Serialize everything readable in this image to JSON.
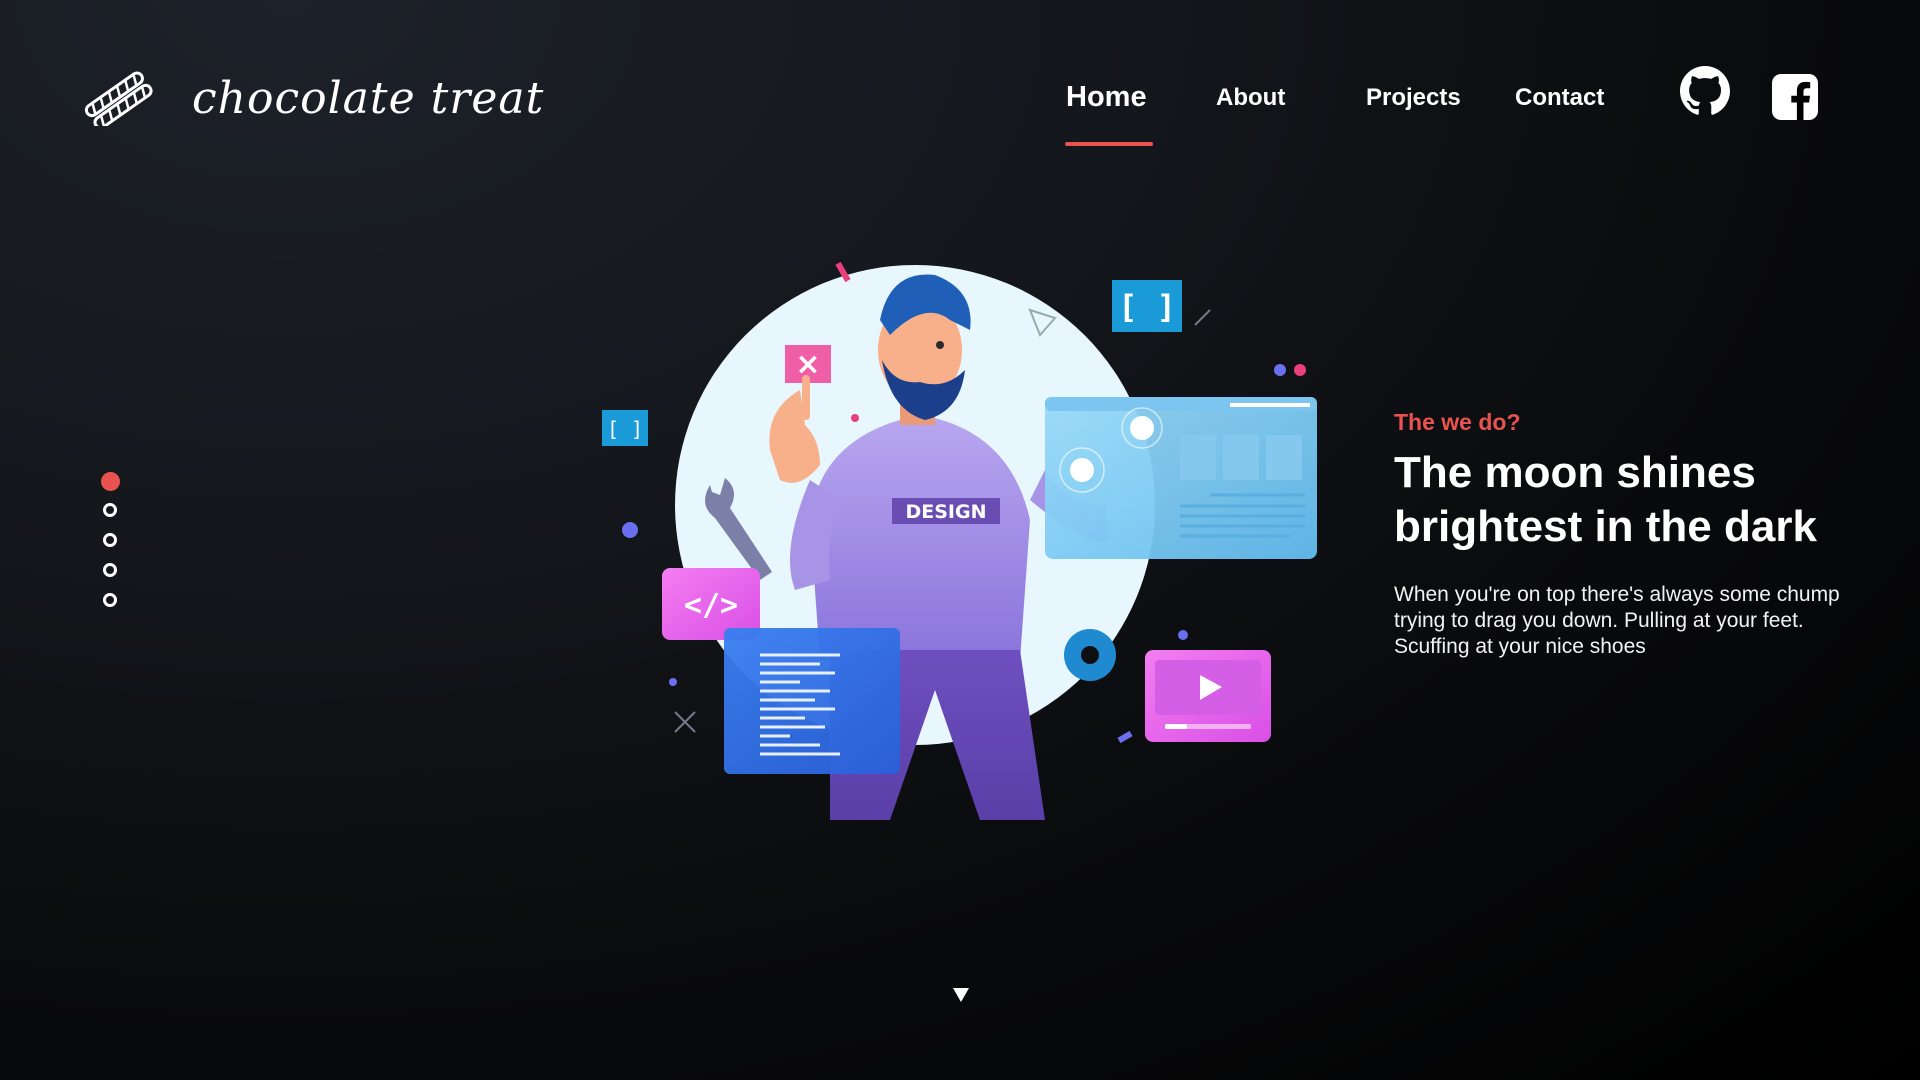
{
  "brand": {
    "name": "chocolate treat",
    "logo_icon": "double-stripe-logo"
  },
  "nav": {
    "items": [
      {
        "label": "Home",
        "active": true
      },
      {
        "label": "About",
        "active": false
      },
      {
        "label": "Projects",
        "active": false
      },
      {
        "label": "Contact",
        "active": false
      }
    ],
    "active_color": "#e8534f"
  },
  "social": [
    {
      "icon": "github-icon"
    },
    {
      "icon": "facebook-icon"
    }
  ],
  "slider": {
    "count": 5,
    "active_index": 0
  },
  "hero": {
    "eyebrow": "The we do?",
    "headline_line1": "The moon shines",
    "headline_line2": "brightest in the dark",
    "body_line1": "When you're on top there's always some chump",
    "body_line2": "trying to drag you down. Pulling at your feet.",
    "body_line3": "Scuffing at your nice shoes",
    "illustration_badge": "DESIGN",
    "accent_color": "#e8534f"
  },
  "scroll_indicator": {
    "icon": "triangle-down-icon"
  }
}
